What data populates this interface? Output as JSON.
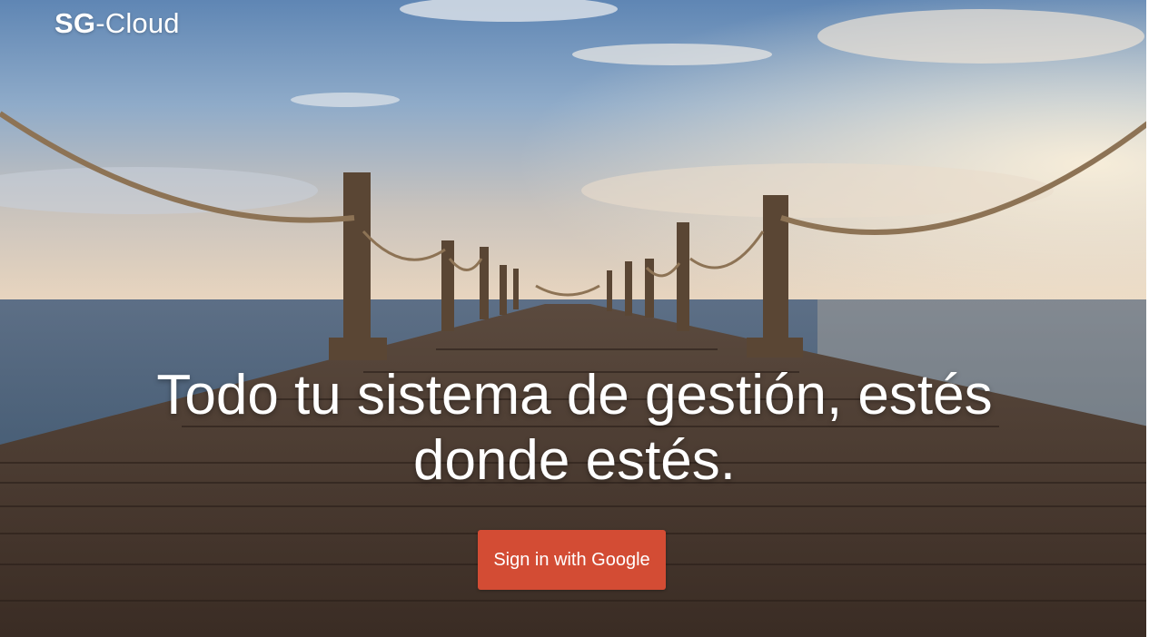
{
  "brand": {
    "bold": "SG",
    "rest": "-Cloud"
  },
  "hero": {
    "headline_line1": "Todo tu sistema de gestión, estés",
    "headline_line2": "donde estés."
  },
  "cta": {
    "label": "Sign in with Google",
    "color": "#d34c34"
  }
}
